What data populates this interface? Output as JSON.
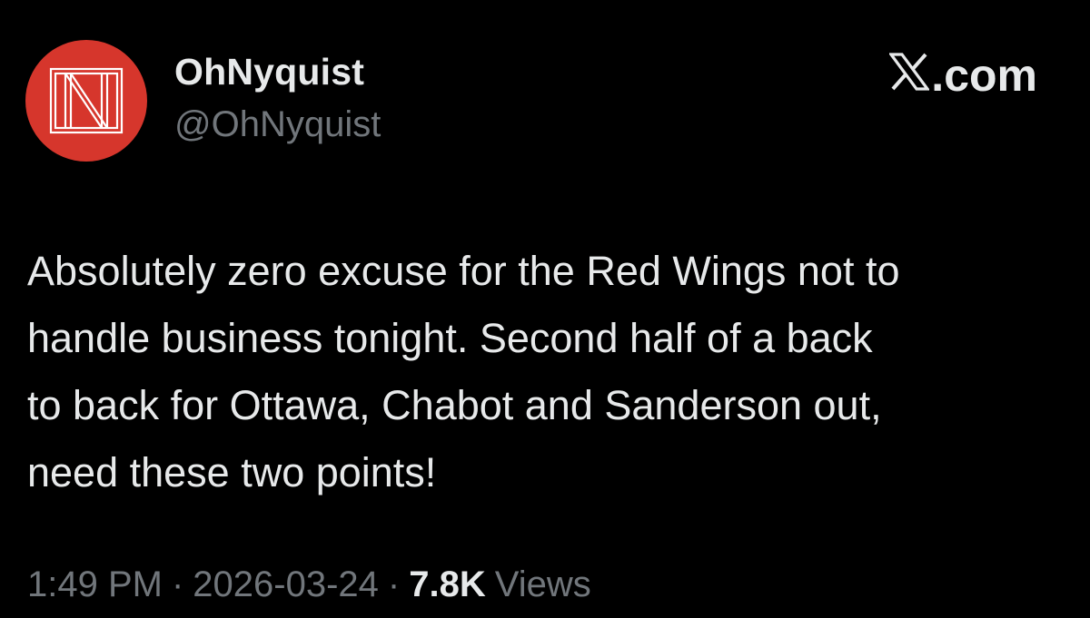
{
  "tweet": {
    "author": {
      "display_name": "OhNyquist",
      "handle": "@OhNyquist",
      "avatar_icon": "on-monogram-logo",
      "avatar_color": "#d6362c"
    },
    "brand": {
      "icon": "x-logo-icon",
      "suffix": ".com"
    },
    "text": "Absolutely zero excuse for the Red Wings not to\nhandle business tonight. Second half of a back\nto back for Ottawa, Chabot and Sanderson out,\nneed these two points!",
    "meta": {
      "time": "1:49 PM",
      "separator": "·",
      "date": "2026-03-24",
      "views_count": "7.8K",
      "views_label": "Views"
    }
  },
  "colors": {
    "background": "#000000",
    "primary_text": "#e7e9ea",
    "secondary_text": "#71767b"
  }
}
